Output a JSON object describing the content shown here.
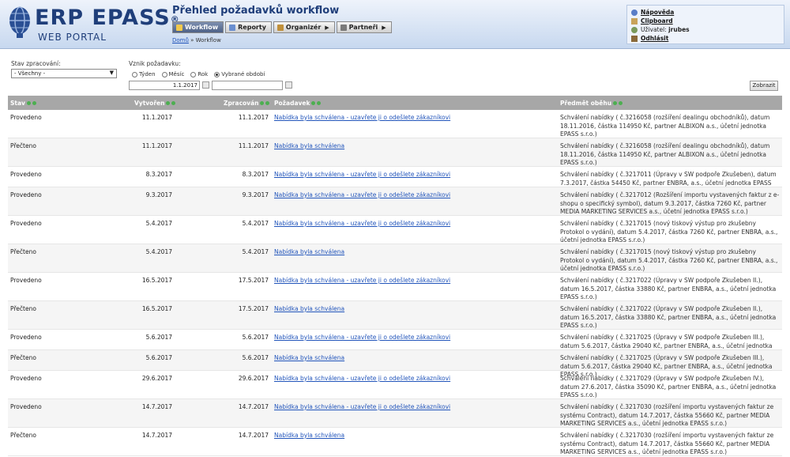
{
  "header": {
    "logo_main": "ERP EPASS",
    "logo_reg": "®",
    "logo_sub": "WEB PORTAL",
    "title": "Přehled požadavků workflow",
    "menu": [
      {
        "label": "Workflow",
        "icon": "workflow-icon",
        "active": true
      },
      {
        "label": "Reporty",
        "icon": "report-icon",
        "active": false
      },
      {
        "label": "Organizér",
        "icon": "organizer-icon",
        "active": false,
        "arrow": "▶"
      },
      {
        "label": "Partneři",
        "icon": "partners-icon",
        "active": false,
        "arrow": "▶"
      }
    ],
    "breadcrumb": {
      "home": "Domů",
      "sep": " » ",
      "current": "Workflow"
    },
    "user_box": {
      "help": "Nápověda",
      "clipboard": "Clipboard",
      "user_label": "Uživatel:",
      "user_name": "jrubes",
      "logout": "Odhlásit"
    }
  },
  "filters": {
    "state_label": "Stav zpracování:",
    "state_value": "- Všechny -",
    "origin_label": "Vznik požadavku:",
    "periods": [
      {
        "label": "Týden",
        "checked": false
      },
      {
        "label": "Měsíc",
        "checked": false
      },
      {
        "label": "Rok",
        "checked": false
      },
      {
        "label": "Vybrané období",
        "checked": true
      }
    ],
    "date_from": "1.1.2017",
    "date_to": "",
    "show_button": "Zobrazit"
  },
  "table": {
    "columns": {
      "state": "Stav",
      "created": "Vytvořen",
      "processed": "Zpracován",
      "request": "Požadavek",
      "subject": "Předmět oběhu"
    },
    "rows": [
      {
        "state": "Provedeno",
        "created": "11.1.2017",
        "processed": "11.1.2017",
        "request": "Nabídka byla schválena - uzavřete ji o odešlete zákazníkovi",
        "subject": "Schválení nabídky ( č.3216058 (rozšíření dealingu obchodníků), datum 18.11.2016, částka 114950 Kč, partner ALBIXON a.s., účetní jednotka EPASS s.r.o.)",
        "lines": 3
      },
      {
        "state": "Přečteno",
        "created": "11.1.2017",
        "processed": "11.1.2017",
        "request": "Nabídka byla schválena",
        "subject": "Schválení nabídky ( č.3216058 (rozšíření dealingu obchodníků), datum 18.11.2016, částka 114950 Kč, partner ALBIXON a.s., účetní jednotka EPASS s.r.o.)",
        "lines": 3
      },
      {
        "state": "Provedeno",
        "created": "8.3.2017",
        "processed": "8.3.2017",
        "request": "Nabídka byla schválena - uzavřete ji o odešlete zákazníkovi",
        "subject": "Schválení nabídky ( č.3217011 (Úpravy v SW podpoře Zkušeben), datum 7.3.2017, částka 54450 Kč, partner ENBRA, a.s., účetní jednotka EPASS s.r.o.)",
        "lines": 2
      },
      {
        "state": "Provedeno",
        "created": "9.3.2017",
        "processed": "9.3.2017",
        "request": "Nabídka byla schválena - uzavřete ji o odešlete zákazníkovi",
        "subject": "Schválení nabídky ( č.3217012 (Rozšíření importu vystavených faktur z e-shopu o specifický symbol), datum 9.3.2017, částka 7260 Kč, partner MEDIA MARKETING SERVICES a.s., účetní jednotka EPASS s.r.o.)",
        "lines": 3
      },
      {
        "state": "Provedeno",
        "created": "5.4.2017",
        "processed": "5.4.2017",
        "request": "Nabídka byla schválena - uzavřete ji o odešlete zákazníkovi",
        "subject": "Schválení nabídky ( č.3217015 (nový tiskový výstup pro zkušebny Protokol o vydání), datum 5.4.2017, částka 7260 Kč, partner ENBRA, a.s., účetní jednotka EPASS s.r.o.)",
        "lines": 3
      },
      {
        "state": "Přečteno",
        "created": "5.4.2017",
        "processed": "5.4.2017",
        "request": "Nabídka byla schválena",
        "subject": "Schválení nabídky ( č.3217015 (nový tiskový výstup pro zkušebny Protokol o vydání), datum 5.4.2017, částka 7260 Kč, partner ENBRA, a.s., účetní jednotka EPASS s.r.o.)",
        "lines": 3
      },
      {
        "state": "Provedeno",
        "created": "16.5.2017",
        "processed": "17.5.2017",
        "request": "Nabídka byla schválena - uzavřete ji o odešlete zákazníkovi",
        "subject": "Schválení nabídky ( č.3217022 (Úpravy v SW podpoře Zkušeben II.), datum 16.5.2017, částka 33880 Kč, partner ENBRA, a.s., účetní jednotka EPASS s.r.o.)",
        "lines": 3
      },
      {
        "state": "Přečteno",
        "created": "16.5.2017",
        "processed": "17.5.2017",
        "request": "Nabídka byla schválena",
        "subject": "Schválení nabídky ( č.3217022 (Úpravy v SW podpoře Zkušeben II.), datum 16.5.2017, částka 33880 Kč, partner ENBRA, a.s., účetní jednotka EPASS s.r.o.)",
        "lines": 3
      },
      {
        "state": "Provedeno",
        "created": "5.6.2017",
        "processed": "5.6.2017",
        "request": "Nabídka byla schválena - uzavřete ji o odešlete zákazníkovi",
        "subject": "Schválení nabídky ( č.3217025 (Úpravy v SW podpoře Zkušeben III.), datum 5.6.2017, částka 29040 Kč, partner ENBRA, a.s., účetní jednotka EPASS s.r.o.)",
        "lines": 2
      },
      {
        "state": "Přečteno",
        "created": "5.6.2017",
        "processed": "5.6.2017",
        "request": "Nabídka byla schválena",
        "subject": "Schválení nabídky ( č.3217025 (Úpravy v SW podpoře Zkušeben III.), datum 5.6.2017, částka 29040 Kč, partner ENBRA, a.s., účetní jednotka EPASS s.r.o.)",
        "lines": 2
      },
      {
        "state": "Provedeno",
        "created": "29.6.2017",
        "processed": "29.6.2017",
        "request": "Nabídka byla schválena - uzavřete ji o odešlete zákazníkovi",
        "subject": "Schválení nabídky ( č.3217029 (Úpravy v SW podpoře Zkušeben IV.), datum 27.6.2017, částka 35090 Kč, partner ENBRA, a.s., účetní jednotka EPASS s.r.o.)",
        "lines": 3
      },
      {
        "state": "Provedeno",
        "created": "14.7.2017",
        "processed": "14.7.2017",
        "request": "Nabídka byla schválena - uzavřete ji o odešlete zákazníkovi",
        "subject": "Schválení nabídky ( č.3217030 (rozšíření importu vystavených faktur ze systému Contract), datum 14.7.2017, částka 55660 Kč, partner MEDIA MARKETING SERVICES a.s., účetní jednotka EPASS s.r.o.)",
        "lines": 3
      },
      {
        "state": "Přečteno",
        "created": "14.7.2017",
        "processed": "14.7.2017",
        "request": "Nabídka byla schválena",
        "subject": "Schválení nabídky ( č.3217030 (rozšíření importu vystavených faktur ze systému Contract), datum 14.7.2017, částka 55660 Kč, partner MEDIA MARKETING SERVICES a.s., účetní jednotka EPASS s.r.o.)",
        "lines": 3
      }
    ]
  },
  "colors": {
    "brand": "#1f3e7a",
    "link": "#2255bb",
    "header_bg": "#c7d8ef",
    "table_head": "#a7a7a7",
    "sort_icon": "#4caf50"
  }
}
